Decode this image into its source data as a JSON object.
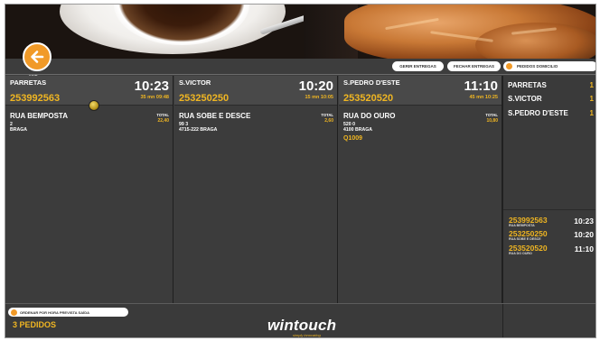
{
  "header": {
    "exit_label": "SAIR"
  },
  "toolbar": {
    "manage_label": "GERIR ENTREGAS",
    "close_label": "FECHAR ENTREGAS",
    "home_orders_label": "PEDIDOS DOMICILIO"
  },
  "orders": [
    {
      "name": "PARRETAS",
      "time": "10:23",
      "phone": "253992563",
      "delay": "35 mn 09:48",
      "street": "RUA BEMPOSTA",
      "number": "2",
      "city": "BRAGA",
      "ref": "",
      "total_label": "TOTAL",
      "total": "22,40"
    },
    {
      "name": "S.VICTOR",
      "time": "10:20",
      "phone": "253250250",
      "delay": "15 mn 10:05",
      "street": "RUA SOBE E DESCE",
      "number": "99 3",
      "city": "4715-222 BRAGA",
      "ref": "",
      "total_label": "TOTAL",
      "total": "2,60"
    },
    {
      "name": "S.PEDRO D'ESTE",
      "time": "11:10",
      "phone": "253520520",
      "delay": "45 mn 10:25",
      "street": "RUA DO OURO",
      "number": "520 0",
      "city": "4100 BRAGA",
      "ref": "Q1009",
      "total_label": "TOTAL",
      "total": "10,80"
    }
  ],
  "summary": {
    "counts": [
      {
        "name": "PARRETAS",
        "count": "1"
      },
      {
        "name": "S.VICTOR",
        "count": "1"
      },
      {
        "name": "S.PEDRO D'ESTE",
        "count": "1"
      }
    ],
    "list": [
      {
        "phone": "253992563",
        "street": "RUA BEMPOSTA",
        "time": "10:23"
      },
      {
        "phone": "253250250",
        "street": "RUA SOBE E DESCE",
        "time": "10:20"
      },
      {
        "phone": "253520520",
        "street": "RUA DO OURO",
        "time": "11:10"
      }
    ]
  },
  "footer": {
    "sort_label": "ORDENAR POR HORA PREVISTA SAÍDA",
    "orders_count": "3 PEDIDOS",
    "logo": "wintouch",
    "logo_tagline": "simply innovating"
  },
  "colors": {
    "accent": "#f19a28",
    "highlight": "#f0b622",
    "panel": "#3c3c3c"
  }
}
